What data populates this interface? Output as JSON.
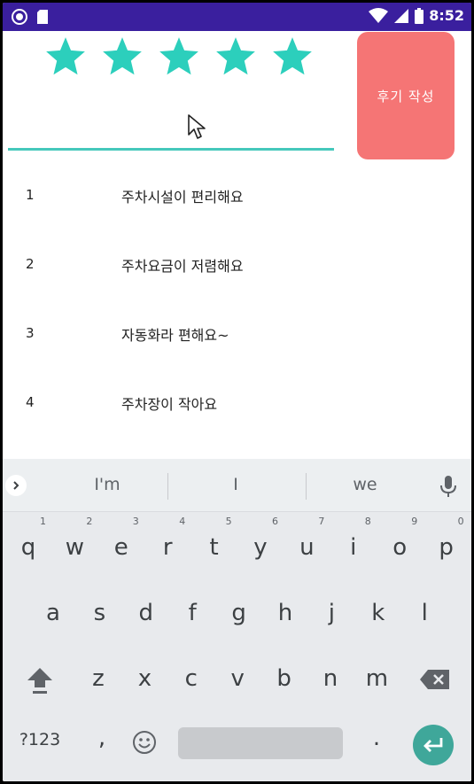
{
  "status_bar": {
    "time": "8:52",
    "left_icons": [
      "record-icon",
      "sim-card-icon"
    ],
    "right_icons": [
      "wifi-icon",
      "cell-signal-icon",
      "battery-icon"
    ],
    "background_color": "#3a1f9e"
  },
  "rating": {
    "star_count": 5,
    "filled": 5,
    "star_color": "#2ccfbc"
  },
  "review_button": {
    "label": "후기 작성",
    "color": "#f57575"
  },
  "review_input": {
    "value": "",
    "placeholder": "",
    "underline_color": "#45c8bb"
  },
  "reviews": [
    {
      "num": "1",
      "text": "주차시설이 편리해요"
    },
    {
      "num": "2",
      "text": "주차요금이 저렴해요"
    },
    {
      "num": "3",
      "text": "자동화라 편해요~"
    },
    {
      "num": "4",
      "text": "주차장이 작아요"
    }
  ],
  "keyboard": {
    "suggestions": [
      "I'm",
      "I",
      "we"
    ],
    "row1": [
      {
        "key": "q",
        "hint": "1"
      },
      {
        "key": "w",
        "hint": "2"
      },
      {
        "key": "e",
        "hint": "3"
      },
      {
        "key": "r",
        "hint": "4"
      },
      {
        "key": "t",
        "hint": "5"
      },
      {
        "key": "y",
        "hint": "6"
      },
      {
        "key": "u",
        "hint": "7"
      },
      {
        "key": "i",
        "hint": "8"
      },
      {
        "key": "o",
        "hint": "9"
      },
      {
        "key": "p",
        "hint": "0"
      }
    ],
    "row2": [
      "a",
      "s",
      "d",
      "f",
      "g",
      "h",
      "j",
      "k",
      "l"
    ],
    "row3": [
      "z",
      "x",
      "c",
      "v",
      "b",
      "n",
      "m"
    ],
    "symbols_label": "?123",
    "comma_label": ",",
    "period_label": ".",
    "enter_color": "#3fa79a"
  }
}
